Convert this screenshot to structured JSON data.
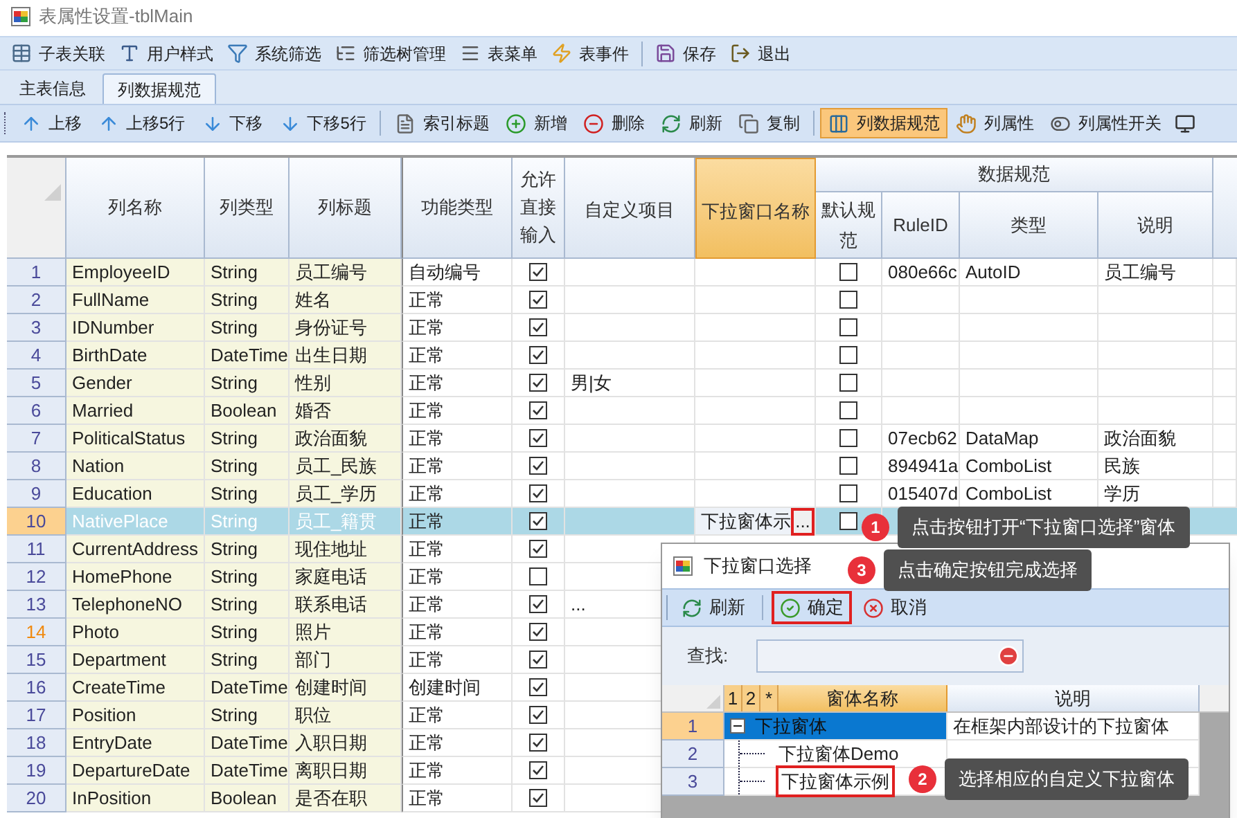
{
  "window": {
    "title": "表属性设置-tblMain"
  },
  "main_toolbar": [
    {
      "label": "子表关联"
    },
    {
      "label": "用户样式"
    },
    {
      "label": "系统筛选"
    },
    {
      "label": "筛选树管理"
    },
    {
      "label": "表菜单"
    },
    {
      "label": "表事件"
    },
    {
      "label": "保存"
    },
    {
      "label": "退出"
    }
  ],
  "tabs": [
    {
      "label": "主表信息",
      "selected": false
    },
    {
      "label": "列数据规范",
      "selected": true
    }
  ],
  "column_toolbar": [
    {
      "label": "上移",
      "selected": false
    },
    {
      "label": "上移5行",
      "selected": false
    },
    {
      "label": "下移",
      "selected": false
    },
    {
      "label": "下移5行",
      "selected": false
    },
    {
      "label": "索引标题",
      "selected": false
    },
    {
      "label": "新增",
      "selected": false
    },
    {
      "label": "删除",
      "selected": false
    },
    {
      "label": "刷新",
      "selected": false
    },
    {
      "label": "复制",
      "selected": false
    },
    {
      "label": "列数据规范",
      "selected": true
    },
    {
      "label": "列属性",
      "selected": false
    },
    {
      "label": "列属性开关",
      "selected": false
    }
  ],
  "grid": {
    "columns": [
      "列名称",
      "列类型",
      "列标题",
      "功能类型",
      "允许直接输入",
      "自定义项目",
      "下拉窗口名称"
    ],
    "group": {
      "title": "数据规范",
      "columns": [
        "默认规范",
        "RuleID",
        "类型",
        "说明"
      ]
    },
    "rows": [
      {
        "num": "1",
        "name": "EmployeeID",
        "type": "String",
        "title": "员工编号",
        "function": "自动编号",
        "allow_input": true,
        "default_rule": false,
        "rule_id": "080e66c",
        "rule_type": "AutoID",
        "rule_desc": "员工编号",
        "selected": false,
        "hot": false
      },
      {
        "num": "2",
        "name": "FullName",
        "type": "String",
        "title": "姓名",
        "function": "正常",
        "allow_input": true,
        "default_rule": false,
        "selected": false,
        "hot": false
      },
      {
        "num": "3",
        "name": "IDNumber",
        "type": "String",
        "title": "身份证号",
        "function": "正常",
        "allow_input": true,
        "default_rule": false,
        "selected": false,
        "hot": false
      },
      {
        "num": "4",
        "name": "BirthDate",
        "type": "DateTime",
        "title": "出生日期",
        "function": "正常",
        "allow_input": true,
        "default_rule": false,
        "selected": false,
        "hot": false
      },
      {
        "num": "5",
        "name": "Gender",
        "type": "String",
        "title": "性别",
        "function": "正常",
        "allow_input": true,
        "custom": "男|女",
        "default_rule": false,
        "selected": false,
        "hot": false
      },
      {
        "num": "6",
        "name": "Married",
        "type": "Boolean",
        "title": "婚否",
        "function": "正常",
        "allow_input": true,
        "default_rule": false,
        "selected": false,
        "hot": false
      },
      {
        "num": "7",
        "name": "PoliticalStatus",
        "type": "String",
        "title": "政治面貌",
        "function": "正常",
        "allow_input": true,
        "default_rule": false,
        "rule_id": "07ecb62",
        "rule_type": "DataMap",
        "rule_desc": "政治面貌",
        "selected": false,
        "hot": false
      },
      {
        "num": "8",
        "name": "Nation",
        "type": "String",
        "title": "员工_民族",
        "function": "正常",
        "allow_input": true,
        "default_rule": false,
        "rule_id": "894941a",
        "rule_type": "ComboList",
        "rule_desc": "民族",
        "selected": false,
        "hot": false
      },
      {
        "num": "9",
        "name": "Education",
        "type": "String",
        "title": "员工_学历",
        "function": "正常",
        "allow_input": true,
        "default_rule": false,
        "rule_id": "015407d",
        "rule_type": "ComboList",
        "rule_desc": "学历",
        "selected": false,
        "hot": false
      },
      {
        "num": "10",
        "name": "NativePlace",
        "type": "String",
        "title": "员工_籍贯",
        "function": "正常",
        "allow_input": true,
        "dropdown": {
          "text": "下拉窗体示",
          "button": "...",
          "outlined": true
        },
        "default_rule": false,
        "selected": true,
        "hot": false
      },
      {
        "num": "11",
        "name": "CurrentAddress",
        "type": "String",
        "title": "现住地址",
        "function": "正常",
        "allow_input": true,
        "selected": false,
        "hot": false
      },
      {
        "num": "12",
        "name": "HomePhone",
        "type": "String",
        "title": "家庭电话",
        "function": "正常",
        "allow_input": false,
        "selected": false,
        "hot": false
      },
      {
        "num": "13",
        "name": "TelephoneNO",
        "type": "String",
        "title": "联系电话",
        "function": "正常",
        "allow_input": true,
        "custom": "...",
        "selected": false,
        "hot": false
      },
      {
        "num": "14",
        "name": "Photo",
        "type": "String",
        "title": "照片",
        "function": "正常",
        "allow_input": true,
        "selected": false,
        "hot": true
      },
      {
        "num": "15",
        "name": "Department",
        "type": "String",
        "title": "部门",
        "function": "正常",
        "allow_input": true,
        "selected": false,
        "hot": false
      },
      {
        "num": "16",
        "name": "CreateTime",
        "type": "DateTime",
        "title": "创建时间",
        "function": "创建时间",
        "allow_input": true,
        "selected": false,
        "hot": false
      },
      {
        "num": "17",
        "name": "Position",
        "type": "String",
        "title": "职位",
        "function": "正常",
        "allow_input": true,
        "selected": false,
        "hot": false
      },
      {
        "num": "18",
        "name": "EntryDate",
        "type": "DateTime",
        "title": "入职日期",
        "function": "正常",
        "allow_input": true,
        "selected": false,
        "hot": false
      },
      {
        "num": "19",
        "name": "DepartureDate",
        "type": "DateTime",
        "title": "离职日期",
        "function": "正常",
        "allow_input": true,
        "selected": false,
        "hot": false
      },
      {
        "num": "20",
        "name": "InPosition",
        "type": "Boolean",
        "title": "是否在职",
        "function": "正常",
        "allow_input": true,
        "selected": false,
        "hot": false
      }
    ]
  },
  "dialog": {
    "title": "下拉窗口选择",
    "toolbar": [
      {
        "label": "刷新",
        "outlined": false
      },
      {
        "label": "确定",
        "outlined": true
      },
      {
        "label": "取消",
        "outlined": false
      }
    ],
    "search": {
      "label": "查找:"
    },
    "grid": {
      "levels": [
        "1",
        "2",
        "*"
      ],
      "columns": [
        "窗体名称",
        "说明"
      ],
      "rows": [
        {
          "num": "1",
          "name": "下拉窗体",
          "desc": "在框架内部设计的下拉窗体",
          "selected": true,
          "outlined": false,
          "expanded": true,
          "children": [
            {
              "num": "2",
              "name": "下拉窗体Demo",
              "selected": false,
              "outlined": false
            },
            {
              "num": "3",
              "name": "下拉窗体示例",
              "selected": false,
              "outlined": true
            }
          ]
        }
      ]
    }
  },
  "callouts": [
    {
      "number": "1",
      "text": "点击按钮打开“下拉窗口选择”窗体"
    },
    {
      "number": "3",
      "text": "点击确定按钮完成选择"
    },
    {
      "number": "2",
      "text": "选择相应的自定义下拉窗体"
    }
  ]
}
